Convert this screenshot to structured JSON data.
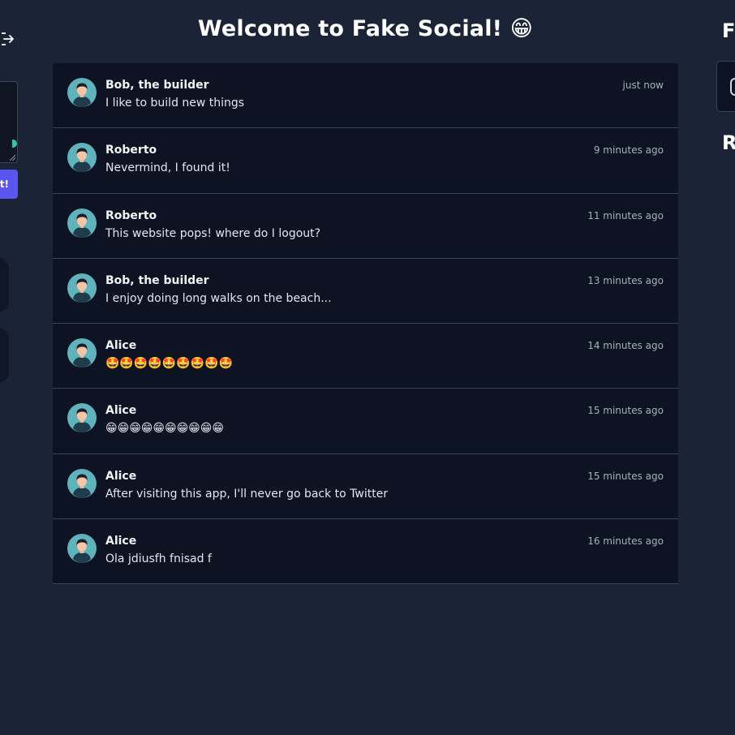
{
  "header": {
    "title": "Welcome to Fake Social! 😁"
  },
  "left_column": {
    "post_button_label": "Post!",
    "logout_icon": "logout-icon"
  },
  "right_column": {
    "heading_1": "F",
    "heading_2": "R"
  },
  "posts": [
    {
      "author": "Bob, the builder",
      "content": "I like to build new things",
      "time": "just now"
    },
    {
      "author": "Roberto",
      "content": "Nevermind, I found it!",
      "time": "9 minutes ago"
    },
    {
      "author": "Roberto",
      "content": "This website pops! where do I logout?",
      "time": "11 minutes ago"
    },
    {
      "author": "Bob, the builder",
      "content": "I enjoy doing long walks on the beach...",
      "time": "13 minutes ago"
    },
    {
      "author": "Alice",
      "content": "🤩🤩🤩🤩🤩🤩🤩🤩🤩",
      "time": "14 minutes ago"
    },
    {
      "author": "Alice",
      "content": "😁😁😁😁😁😁😁😁😁😁",
      "time": "15 minutes ago"
    },
    {
      "author": "Alice",
      "content": "After visiting this app, I'll never go back to Twitter",
      "time": "15 minutes ago"
    },
    {
      "author": "Alice",
      "content": "Ola jdiusfh fnisad f",
      "time": "16 minutes ago"
    }
  ],
  "colors": {
    "background": "#1b2437",
    "feed_background": "#0d1322",
    "accent": "#5b55f0",
    "avatar_bg": "#5fb3bd"
  }
}
